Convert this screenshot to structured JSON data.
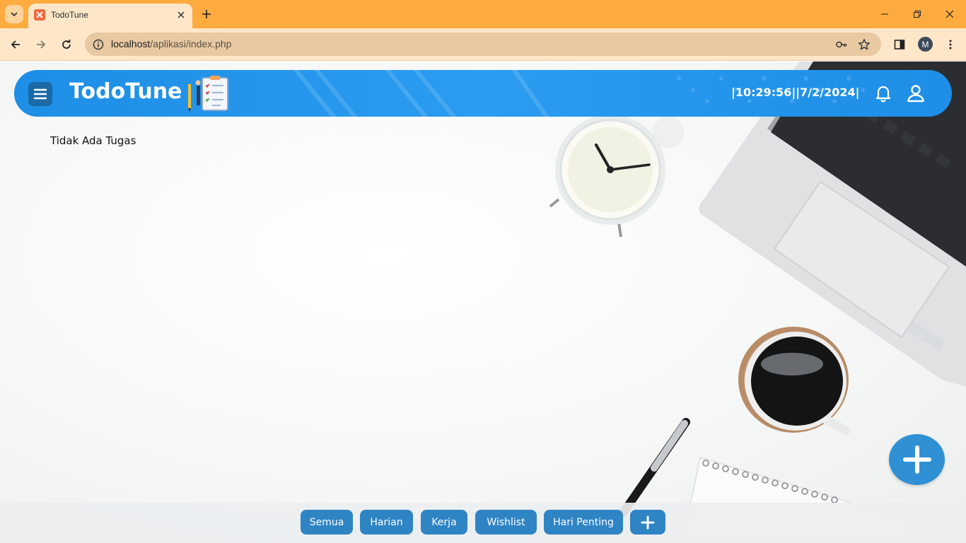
{
  "browser": {
    "tab_title": "TodoTune",
    "url_host": "localhost",
    "url_path": "/aplikasi/index.php",
    "profile_initial": "M",
    "theme_color": "#ffab40"
  },
  "app": {
    "title": "TodoTune",
    "datetime": "|10:29:56||7/2/2024|",
    "empty_message": "Tidak Ada Tugas",
    "header_color": "#2b9cf0",
    "button_color": "#2f84c4"
  },
  "categories": [
    {
      "label": "Semua"
    },
    {
      "label": "Harian"
    },
    {
      "label": "Kerja"
    },
    {
      "label": "Wishlist"
    },
    {
      "label": "Hari Penting"
    }
  ],
  "icons": {
    "menu": "hamburger-icon",
    "notifications": "bell-icon",
    "profile": "user-icon",
    "add_task": "plus-icon",
    "add_category": "plus-icon"
  }
}
